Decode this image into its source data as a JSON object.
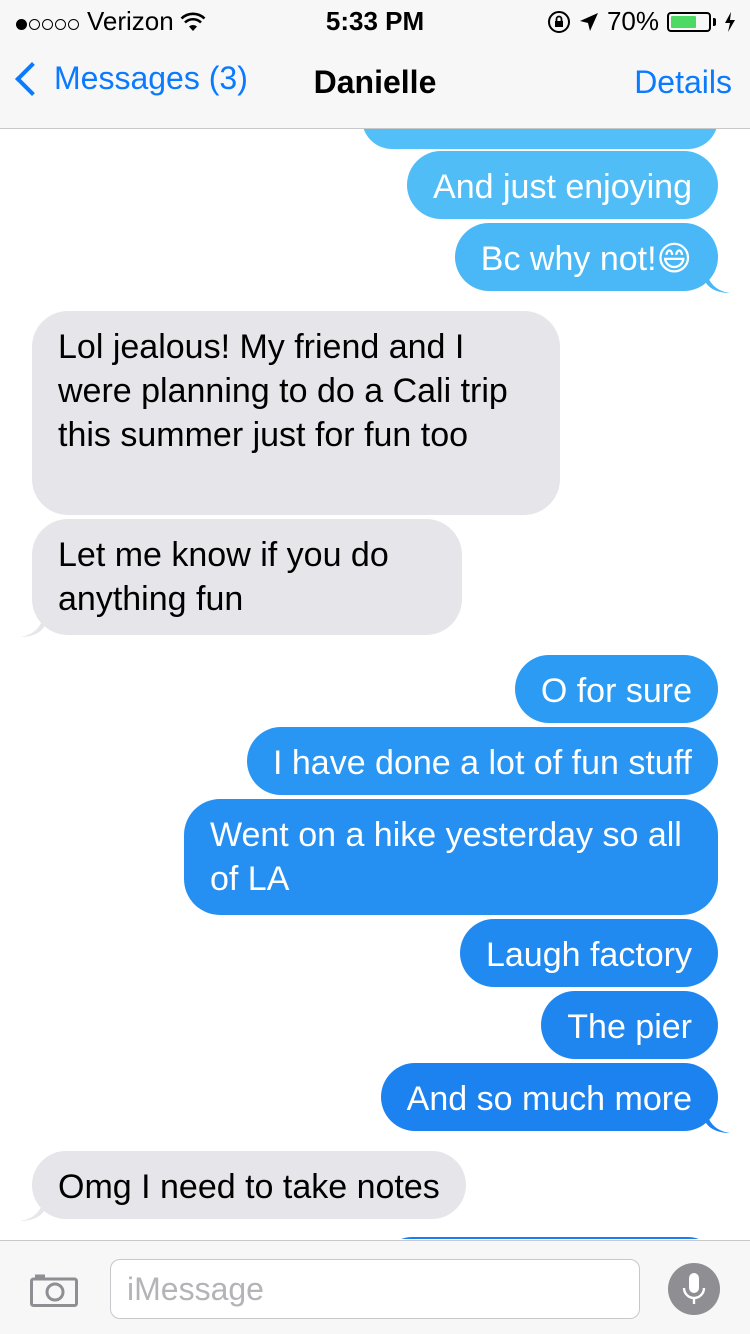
{
  "status_bar": {
    "carrier": "Verizon",
    "time": "5:33 PM",
    "battery": "70%",
    "battery_level": 0.7
  },
  "nav": {
    "back_label": "Messages (3)",
    "title": "Danielle",
    "details_label": "Details"
  },
  "messages": [
    {
      "from": "me",
      "text": "And just enjoying"
    },
    {
      "from": "me",
      "text": "Bc why not!😄"
    },
    {
      "from": "them",
      "text": "Lol jealous! My friend and I were planning to do a Cali trip this summer just for fun too"
    },
    {
      "from": "them",
      "text": "Let me know if you do anything fun"
    },
    {
      "from": "me",
      "text": "O for sure"
    },
    {
      "from": "me",
      "text": "I have done a lot of fun stuff"
    },
    {
      "from": "me",
      "text": "Went on a hike yesterday so all of LA"
    },
    {
      "from": "me",
      "text": "Laugh factory"
    },
    {
      "from": "me",
      "text": "The pier"
    },
    {
      "from": "me",
      "text": "And so much more"
    },
    {
      "from": "them",
      "text": "Omg I need to take notes"
    }
  ],
  "input": {
    "placeholder": "iMessage"
  },
  "colors": {
    "accent": "#0a7aff",
    "outgoing_top": "#5ac8fa",
    "outgoing_bottom": "#1e82f0",
    "incoming": "#e5e5ea"
  },
  "icons": {
    "back": "chevron-left-icon",
    "camera": "camera-icon",
    "mic": "microphone-icon",
    "wifi": "wifi-icon",
    "location": "location-arrow-icon",
    "lock": "orientation-lock-icon",
    "charging": "charging-bolt-icon"
  }
}
